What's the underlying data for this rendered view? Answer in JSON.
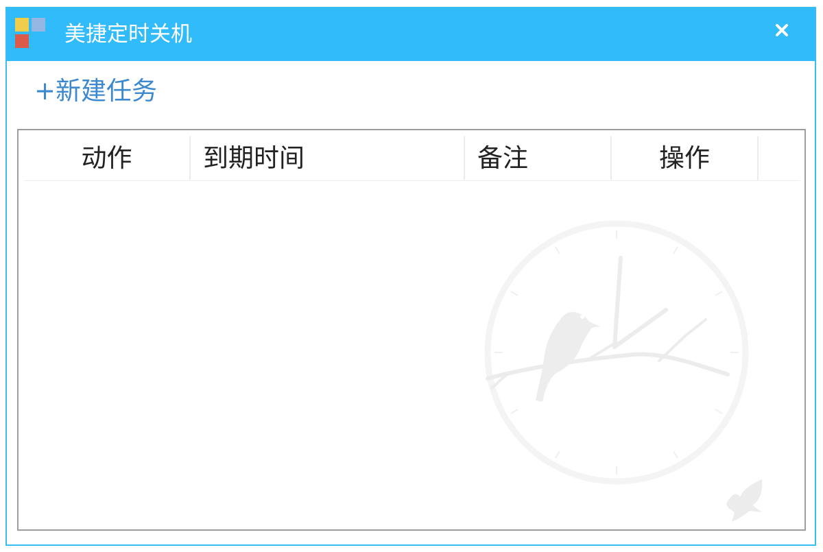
{
  "window": {
    "title": "美捷定时关机",
    "close_icon": "close-icon",
    "logo_icon": "app-logo-icon",
    "colors": {
      "titlebar": "#31bbfa",
      "border": "#36bdf8",
      "link": "#3c89d0"
    }
  },
  "toolbar": {
    "new_task_label": "+新建任务"
  },
  "table": {
    "columns": [
      "动作",
      "到期时间",
      "备注",
      "操作"
    ],
    "rows": []
  },
  "decor": {
    "watermark_icon": "clock-bird-watermark-icon",
    "corner_icon": "bird-icon"
  }
}
